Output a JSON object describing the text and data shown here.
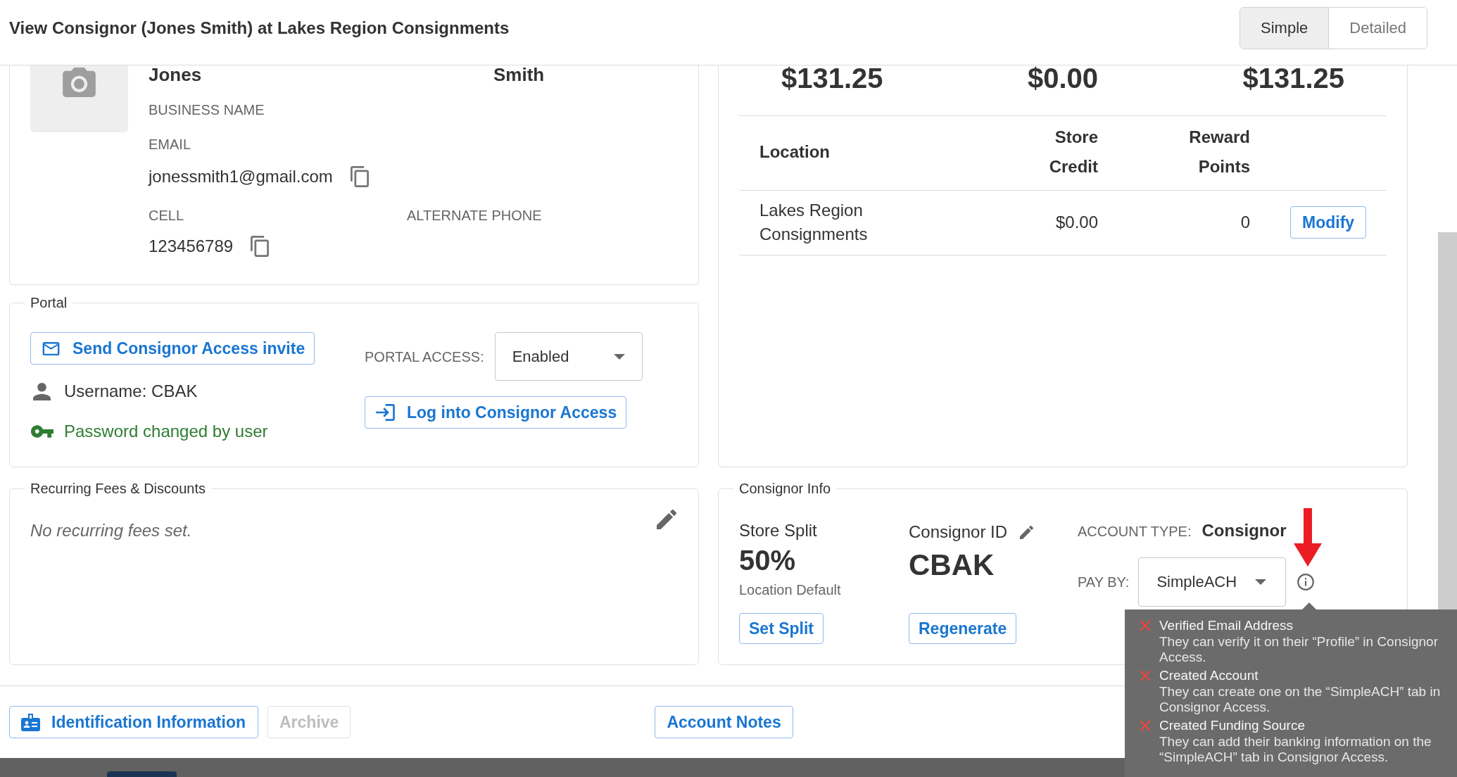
{
  "window": {
    "title": "View Consignor (Jones Smith) at Lakes Region Consignments"
  },
  "view_toggle": [
    {
      "label": "Simple",
      "selected": true
    },
    {
      "label": "Detailed",
      "selected": false
    }
  ],
  "profile": {
    "first_name": "Jones",
    "last_name": "Smith",
    "business_name_label": "BUSINESS NAME",
    "email_label": "EMAIL",
    "email": "jonessmith1@gmail.com",
    "cell_label": "CELL",
    "cell": "123456789",
    "alternate_phone_label": "ALTERNATE PHONE"
  },
  "balances": {
    "amounts": [
      "$131.25",
      "$0.00",
      "$131.25"
    ],
    "table": {
      "columns": [
        "Location",
        "Store Credit",
        "Reward Points"
      ],
      "rows": [
        {
          "location": "Lakes Region Consignments",
          "store_credit": "$0.00",
          "reward_points": "0",
          "action": "Modify"
        }
      ]
    }
  },
  "portal": {
    "title": "Portal",
    "invite_button": "Send Consignor Access invite",
    "username": "Username: CBAK",
    "password_status": "Password changed by user",
    "access_label": "PORTAL ACCESS:",
    "access_value": "Enabled",
    "login_button": "Log into Consignor Access"
  },
  "recurring_fees": {
    "title": "Recurring Fees & Discounts",
    "empty_text": "No recurring fees set."
  },
  "consignor_info": {
    "title": "Consignor Info",
    "store_split_label": "Store Split",
    "store_split": "50%",
    "store_split_source": "Location Default",
    "set_split_button": "Set Split",
    "consignor_id_label": "Consignor ID",
    "consignor_id": "CBAK",
    "regenerate_button": "Regenerate",
    "account_type_label": "ACCOUNT TYPE:",
    "account_type": "Consignor",
    "pay_by_label": "PAY BY:",
    "pay_by": "SimpleACH"
  },
  "pay_by_tooltip": {
    "items": [
      {
        "title": "Verified Email Address",
        "detail": "They can verify it on their “Profile” in Consignor Access.",
        "done": false
      },
      {
        "title": "Created Account",
        "detail": "They can create one on the “SimpleACH” tab in Consignor Access.",
        "done": false
      },
      {
        "title": "Created Funding Source",
        "detail": "They can add their banking information on the “SimpleACH” tab in Consignor Access.",
        "done": false
      }
    ]
  },
  "footer": {
    "identification_button": "Identification Information",
    "archive_button": {
      "label": "Archive",
      "disabled": true
    },
    "notes_button": "Account Notes"
  }
}
